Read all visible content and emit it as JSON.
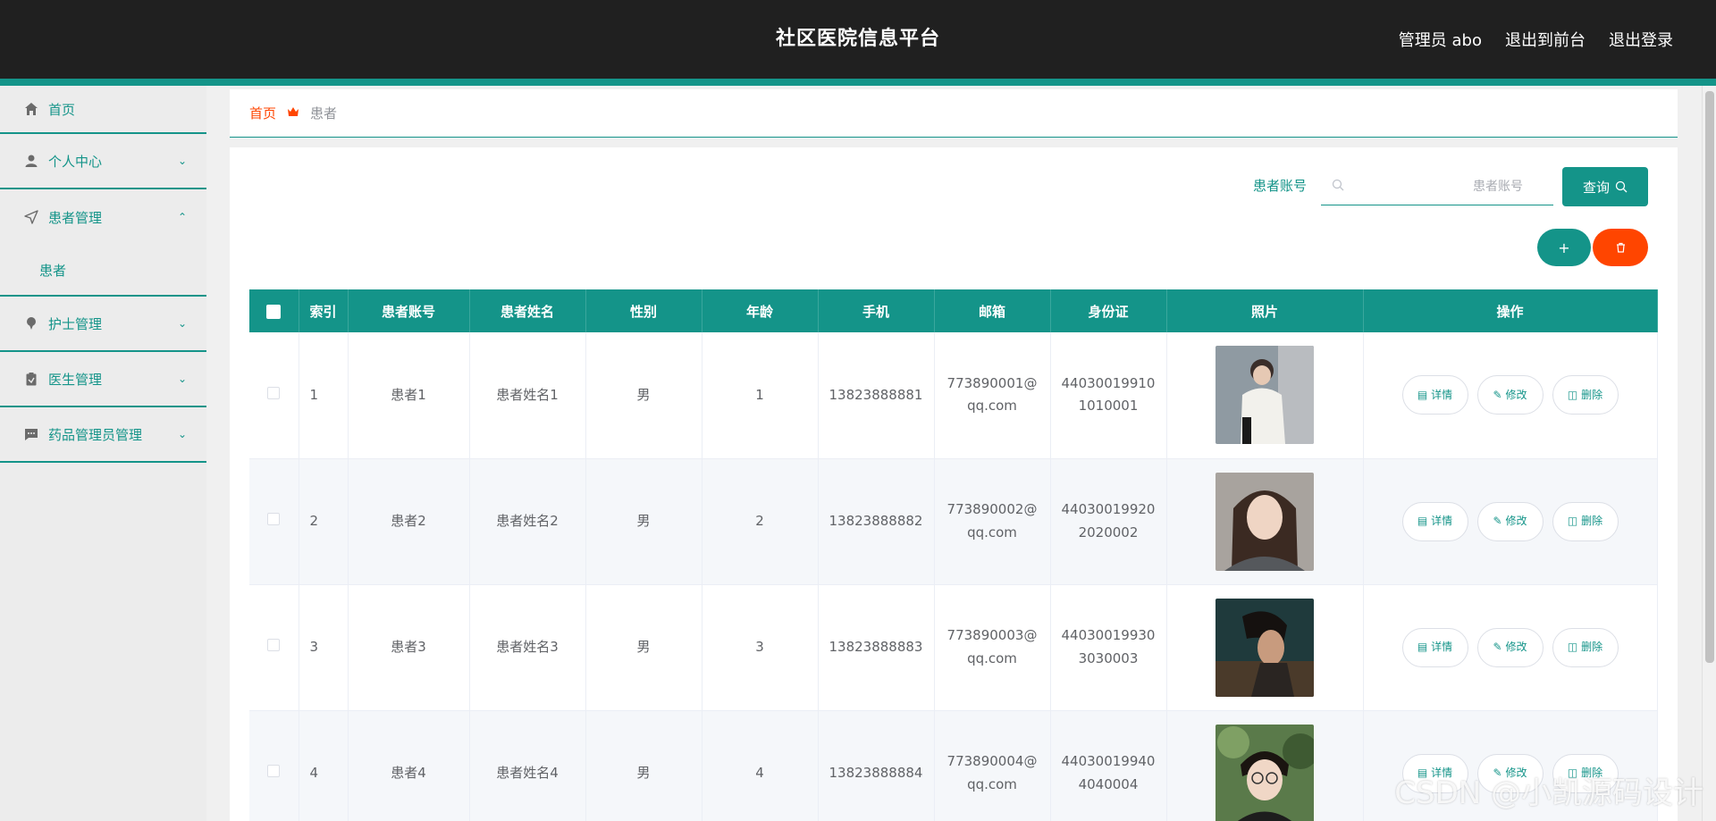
{
  "header": {
    "title": "社区医院信息平台",
    "admin_label": "管理员 abo",
    "back_to_front": "退出到前台",
    "logout": "退出登录"
  },
  "sidebar": {
    "items": [
      {
        "label": "首页",
        "icon": "home-icon"
      },
      {
        "label": "个人中心",
        "icon": "user-icon"
      },
      {
        "label": "患者管理",
        "icon": "send-icon",
        "sub": [
          "患者"
        ]
      },
      {
        "label": "护士管理",
        "icon": "pin-icon"
      },
      {
        "label": "医生管理",
        "icon": "clipboard-icon"
      },
      {
        "label": "药品管理员管理",
        "icon": "chat-icon"
      }
    ]
  },
  "breadcrumb": {
    "home": "首页",
    "current": "患者"
  },
  "search": {
    "label": "患者账号",
    "placeholder": "患者账号",
    "button": "查询"
  },
  "actions": {
    "add": "+"
  },
  "table": {
    "headers": [
      "索引",
      "患者账号",
      "患者姓名",
      "性别",
      "年龄",
      "手机",
      "邮箱",
      "身份证",
      "照片",
      "操作"
    ],
    "rows": [
      {
        "index": "1",
        "account": "患者1",
        "name": "患者姓名1",
        "gender": "男",
        "age": "1",
        "phone": "13823888881",
        "email_1": "773890001@",
        "email_2": "qq.com",
        "id_1": "44030019910",
        "id_2": "1010001"
      },
      {
        "index": "2",
        "account": "患者2",
        "name": "患者姓名2",
        "gender": "男",
        "age": "2",
        "phone": "13823888882",
        "email_1": "773890002@",
        "email_2": "qq.com",
        "id_1": "44030019920",
        "id_2": "2020002"
      },
      {
        "index": "3",
        "account": "患者3",
        "name": "患者姓名3",
        "gender": "男",
        "age": "3",
        "phone": "13823888883",
        "email_1": "773890003@",
        "email_2": "qq.com",
        "id_1": "44030019930",
        "id_2": "3030003"
      },
      {
        "index": "4",
        "account": "患者4",
        "name": "患者姓名4",
        "gender": "男",
        "age": "4",
        "phone": "13823888884",
        "email_1": "773890004@",
        "email_2": "qq.com",
        "id_1": "44030019940",
        "id_2": "4040004"
      }
    ],
    "op_labels": {
      "detail": "详情",
      "edit": "修改",
      "delete": "删除"
    }
  },
  "watermark": "CSDN @小凯源码设计",
  "colors": {
    "primary": "#149489",
    "danger": "#ff4500",
    "topbar": "#202020"
  }
}
